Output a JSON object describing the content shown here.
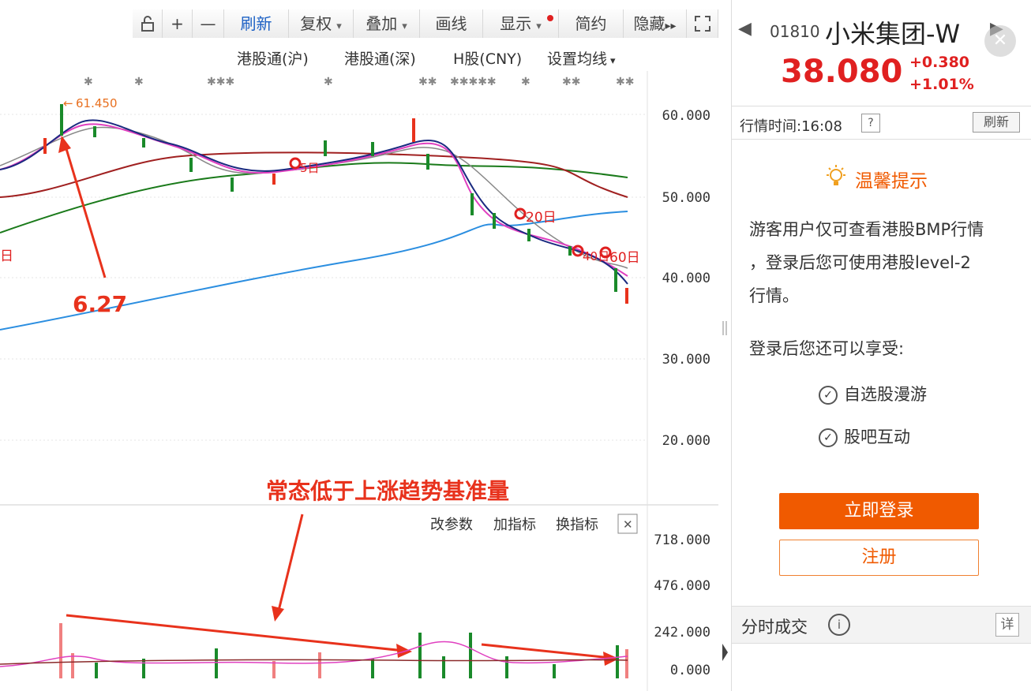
{
  "toolbar": {
    "icons": [
      "unlock-icon",
      "zoom-in-icon",
      "zoom-out-icon"
    ],
    "plus": "+",
    "minus": "—",
    "refresh": "刷新",
    "adjust": "复权",
    "overlay": "叠加",
    "draw": "画线",
    "display": "显示",
    "simple": "简约",
    "hide": "隐藏",
    "hide_arrows": "▸▸",
    "fullscreen": "⛶"
  },
  "subtabs": [
    "港股通(沪)",
    "港股通(深)",
    "H股(CNY)",
    "设置均线"
  ],
  "chart": {
    "peak_label": "61.450",
    "annotation_gain": "6.27",
    "annotation_volume": "常态低于上涨趋势基准量",
    "ma_labels": {
      "m5": "5日",
      "m20": "20日",
      "m40": "40日",
      "m60": "60日",
      "edge": "日"
    },
    "y_axis": [
      "60.000",
      "50.000",
      "40.000",
      "30.000",
      "20.000"
    ],
    "vol_axis": [
      "718.000",
      "476.000",
      "242.000",
      "0.000"
    ],
    "vol_controls": [
      "改参数",
      "加指标",
      "换指标"
    ],
    "vol_close": "✕",
    "up_color": "#e8321c",
    "down_color": "#1a8a2a"
  },
  "panel": {
    "code": "01810",
    "name": "小米集团-W",
    "price": "38.080",
    "change": "+0.380",
    "change_pct": "+1.01%",
    "time_label": "行情时间:16:08",
    "help": "?",
    "refresh": "刷新",
    "tip_title": "温馨提示",
    "tip_text_1": "游客用户仅可查看港股BMP行情",
    "tip_text_2": "，登录后您可使用港股level-2",
    "tip_text_3": "行情。",
    "benefit_title": "登录后您还可以享受:",
    "benefits": [
      "自选股漫游",
      "股吧互动"
    ],
    "login": "立即登录",
    "register": "注册",
    "trades_title": "分时成交",
    "info": "i",
    "detail": "详",
    "price_color": "#e02020"
  }
}
